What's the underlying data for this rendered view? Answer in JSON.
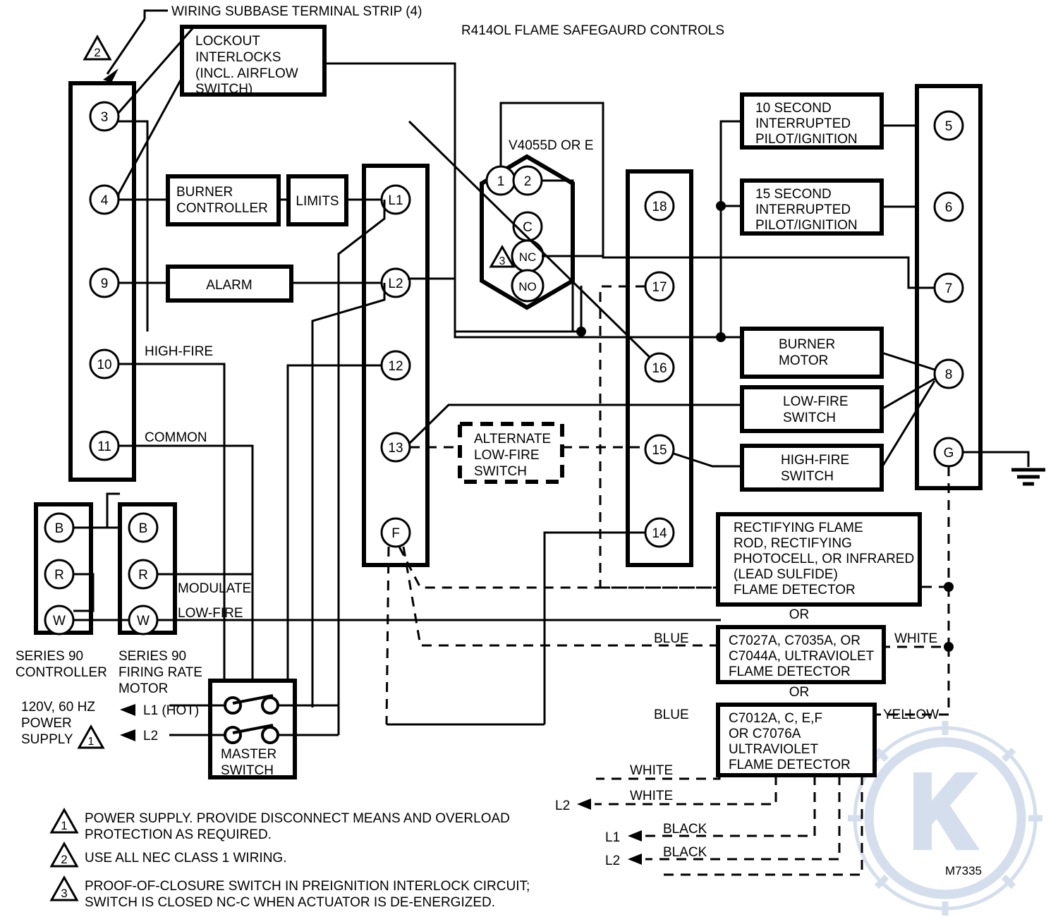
{
  "title": "R414OL FLAME SAFEGAURD CONTROLS",
  "labels": {
    "wiring_subbase": "WIRING SUBBASE TERMINAL STRIP (4)",
    "lockout_interlocks": [
      "LOCKOUT",
      "INTERLOCKS",
      "(INCL. AIRFLOW",
      "SWITCH)"
    ],
    "burner_controller": [
      "BURNER",
      "CONTROLLER"
    ],
    "limits": "LIMITS",
    "alarm": "ALARM",
    "high_fire": "HIGH-FIRE",
    "common": "COMMON",
    "modulate": "MODULATE",
    "low_fire": "LOW-FIRE",
    "v4055": "V4055D OR E",
    "alternate_low_fire": [
      "ALTERNATE",
      "LOW-FIRE",
      "SWITCH"
    ],
    "ten_second": [
      "10 SECOND",
      "INTERRUPTED",
      "PILOT/IGNITION"
    ],
    "fifteen_second": [
      "15 SECOND",
      "INTERRUPTED",
      "PILOT/IGNITION"
    ],
    "burner_motor": [
      "BURNER",
      "MOTOR"
    ],
    "low_fire_switch": [
      "LOW-FIRE",
      "SWITCH"
    ],
    "high_fire_switch": [
      "HIGH-FIRE",
      "SWITCH"
    ],
    "rectifying": [
      "RECTIFYING FLAME",
      "ROD, RECTIFYING",
      "PHOTOCELL, OR INFRARED",
      "(LEAD SULFIDE)",
      "FLAME DETECTOR"
    ],
    "or1": "OR",
    "or2": "OR",
    "uv1": [
      "C7027A, C7035A, OR",
      "C7044A, ULTRAVIOLET",
      "FLAME DETECTOR"
    ],
    "uv2": [
      "C7012A, C, E,F",
      "OR C7076A",
      "ULTRAVIOLET",
      "FLAME DETECTOR"
    ],
    "series90_controller": [
      "SERIES 90",
      "CONTROLLER"
    ],
    "series90_motor": [
      "SERIES 90",
      "FIRING RATE",
      "MOTOR"
    ],
    "power_supply": [
      "120V, 60 HZ",
      "POWER",
      "SUPPLY"
    ],
    "l1_hot": "L1 (HOT)",
    "l2_left": "L2",
    "master_switch": [
      "MASTER",
      "SWITCH"
    ],
    "blue1": "BLUE",
    "blue2": "BLUE",
    "white_right": "WHITE",
    "yellow_right": "YELLOW",
    "white_a": "WHITE",
    "white_b": "WHITE",
    "black_a": "BLACK",
    "black_b": "BLACK",
    "l2_a": "L2",
    "l1_b": "L1",
    "l2_b": "L2",
    "drawing_number": "M7335"
  },
  "terminals": {
    "left_strip": [
      "3",
      "4",
      "9",
      "10",
      "11"
    ],
    "mid_strip": [
      "L1",
      "L2",
      "12",
      "13",
      "F"
    ],
    "valve": [
      "1",
      "2",
      "C",
      "NC",
      "NO"
    ],
    "right_mid_strip": [
      "18",
      "17",
      "16",
      "15",
      "14"
    ],
    "right_strip": [
      "5",
      "6",
      "7",
      "8",
      "G"
    ],
    "series90_controller": [
      "B",
      "R",
      "W"
    ],
    "series90_motor": [
      "B",
      "R",
      "W"
    ]
  },
  "notes": [
    {
      "num": "1",
      "lines": [
        "POWER SUPPLY. PROVIDE DISCONNECT MEANS AND OVERLOAD",
        "PROTECTION AS REQUIRED."
      ]
    },
    {
      "num": "2",
      "lines": [
        "USE ALL NEC CLASS 1 WIRING."
      ]
    },
    {
      "num": "3",
      "lines": [
        "PROOF-OF-CLOSURE SWITCH IN PREIGNITION INTERLOCK CIRCUIT;",
        "SWITCH IS CLOSED NC-C WHEN ACTUATOR IS DE-ENERGIZED."
      ]
    }
  ],
  "note_markers": {
    "top_left": "2",
    "valve": "3",
    "power": "1"
  },
  "colors": {
    "line": "#000000",
    "watermark": "#cdd9ea",
    "background": "#ffffff"
  }
}
